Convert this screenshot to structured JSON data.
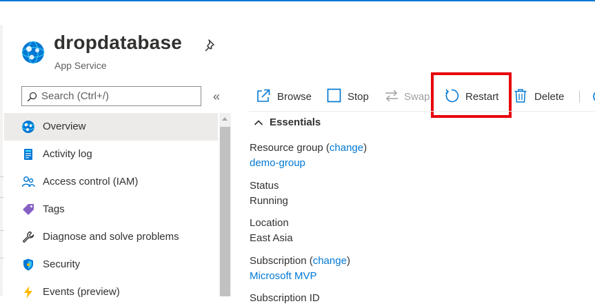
{
  "header": {
    "title": "dropdatabase",
    "subtitle": "App Service"
  },
  "search": {
    "placeholder": "Search (Ctrl+/)",
    "value": ""
  },
  "sidebar": {
    "collapse_label": "«",
    "items": [
      {
        "label": "Overview",
        "icon": "app-service-globe-icon",
        "active": true
      },
      {
        "label": "Activity log",
        "icon": "activity-log-icon"
      },
      {
        "label": "Access control (IAM)",
        "icon": "people-icon"
      },
      {
        "label": "Tags",
        "icon": "tag-icon"
      },
      {
        "label": "Diagnose and solve problems",
        "icon": "wrench-icon"
      },
      {
        "label": "Security",
        "icon": "shield-icon"
      },
      {
        "label": "Events (preview)",
        "icon": "lightning-icon"
      }
    ]
  },
  "toolbar": {
    "browse": "Browse",
    "stop": "Stop",
    "swap": "Swap",
    "restart": "Restart",
    "delete": "Delete"
  },
  "essentials": {
    "header": "Essentials",
    "resource_group": {
      "label": "Resource group",
      "action": "change",
      "value": "demo-group"
    },
    "status": {
      "label": "Status",
      "value": "Running"
    },
    "location": {
      "label": "Location",
      "value": "East Asia"
    },
    "subscription": {
      "label": "Subscription",
      "action": "change",
      "value": "Microsoft MVP"
    },
    "subscription_id": {
      "label": "Subscription ID"
    }
  },
  "colors": {
    "accent": "#0078d4",
    "highlight": "#e8000b",
    "active_row": "#edebe9",
    "text": "#323130"
  }
}
